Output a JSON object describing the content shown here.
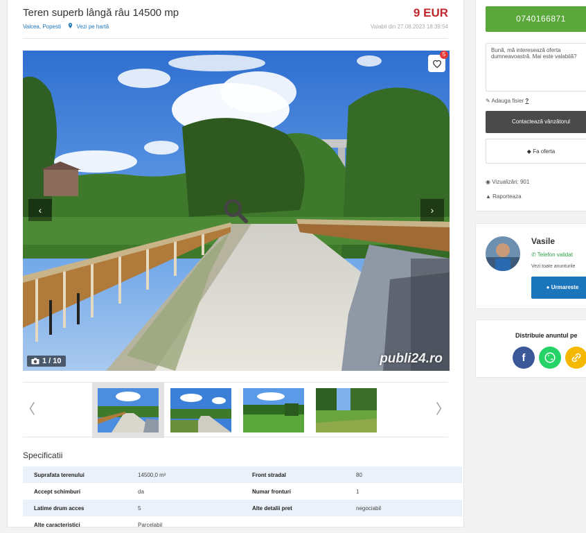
{
  "listing": {
    "title": "Teren superb lângă râu 14500 mp",
    "location": "Valcea, Popesti",
    "map_link": "Vezi pe hartă",
    "price": "9 EUR",
    "valid_since": "Valabil din 27.08.2023 18:39:54"
  },
  "gallery": {
    "favorite_count": "5",
    "counter": "1 / 10",
    "watermark": "publi24.ro",
    "prev_arrow": "‹",
    "next_arrow": "›",
    "thumb_prev": "〈",
    "thumb_next": "〉"
  },
  "specs": {
    "title": "Specificatii",
    "rows": [
      {
        "k1": "Suprafata terenului",
        "v1": "14500,0 m²",
        "k2": "Front stradal",
        "v2": "80"
      },
      {
        "k1": "Accept schimburi",
        "v1": "da",
        "k2": "Numar fronturi",
        "v2": "1"
      },
      {
        "k1": "Latime drum acces",
        "v1": "5",
        "k2": "Alte detalii pret",
        "v2": "negociabil"
      },
      {
        "k1": "Alte caracteristici",
        "v1": "Parcelabil",
        "k2": "",
        "v2": ""
      }
    ]
  },
  "contact": {
    "phone": "0740166871",
    "message": "Bună, mă interesează oferta dumneavoastră. Mai este valabilă?",
    "attach_label": "Adauga fisier",
    "attach_help": "?",
    "contact_button": "Contactează vânzătorul",
    "offer_button": "Fa oferta",
    "views": "Vizualizări: 901",
    "report": "Raporteaza"
  },
  "seller": {
    "name": "Vasile",
    "verified": "Telefon validat",
    "all_ads": "Vezi toate anunturile",
    "follow": "Urmareste"
  },
  "share": {
    "title": "Distribuie anuntul pe",
    "facebook_glyph": "f"
  },
  "colors": {
    "price": "#c0272d",
    "phone_button": "#5aa73a",
    "link": "#1b75bb",
    "verified": "#2e9e48",
    "facebook": "#3b5998",
    "whatsapp": "#25d366",
    "copy_link": "#f5b800"
  }
}
